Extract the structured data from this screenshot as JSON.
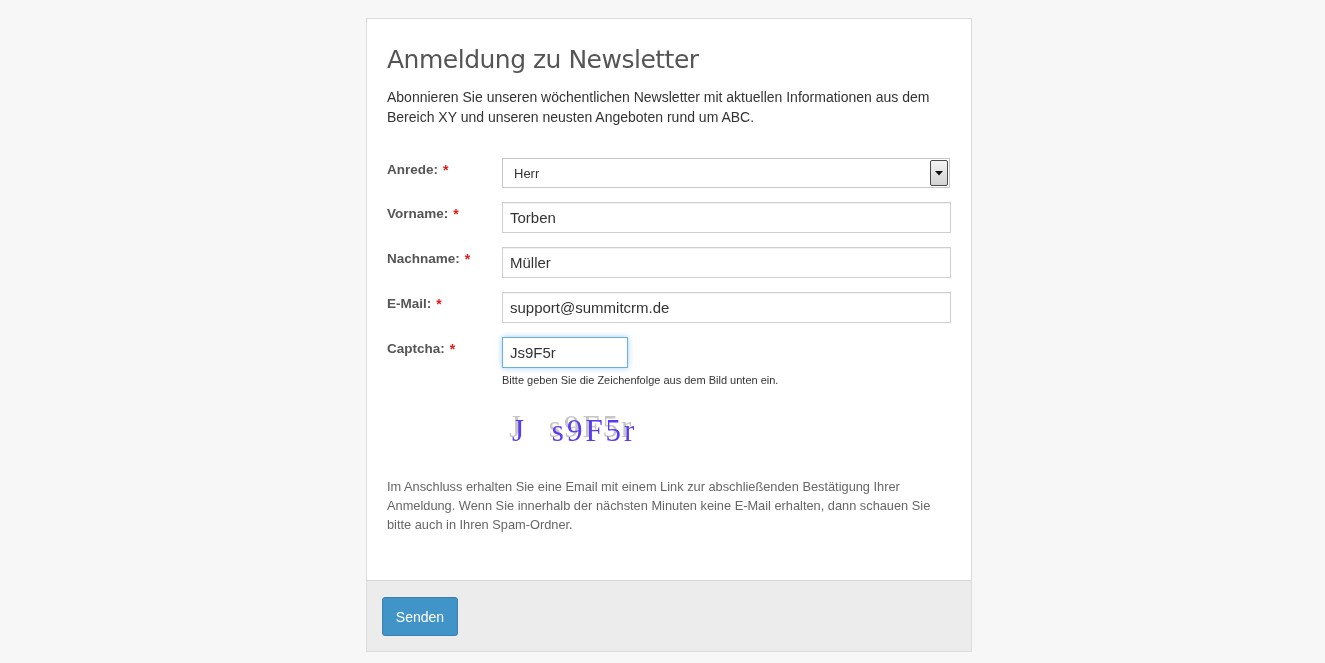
{
  "form": {
    "title": "Anmeldung zu Newsletter",
    "intro": "Abonnieren Sie unseren wöchentlichen Newsletter mit aktuellen Informationen aus dem Bereich XY und unseren neusten Angeboten rund um ABC.",
    "fields": [
      {
        "kind": "select",
        "label": "Anrede:",
        "required_mark": "*",
        "value": "Herr",
        "focused": false
      },
      {
        "kind": "text",
        "label": "Vorname:",
        "required_mark": "*",
        "value": "Torben",
        "focused": false
      },
      {
        "kind": "text",
        "label": "Nachname:",
        "required_mark": "*",
        "value": "Müller",
        "focused": false
      },
      {
        "kind": "text",
        "label": "E-Mail:",
        "required_mark": "*",
        "value": "support@summitcrm.de",
        "focused": false
      },
      {
        "kind": "captcha",
        "label": "Captcha:",
        "required_mark": "*",
        "value": "Js9F5r",
        "focused": true,
        "help": "Bitte geben Sie die Zeichenfolge aus dem Bild unten ein.",
        "image_text": "J s9F5r"
      }
    ],
    "notice": "Im Anschluss erhalten Sie eine Email mit einem Link zur abschließenden Bestätigung Ihrer Anmeldung. Wenn Sie innerhalb der nächsten Minuten keine E-Mail erhalten, dann schauen Sie bitte auch in Ihren Spam-Ordner.",
    "submit_button": "Senden"
  }
}
